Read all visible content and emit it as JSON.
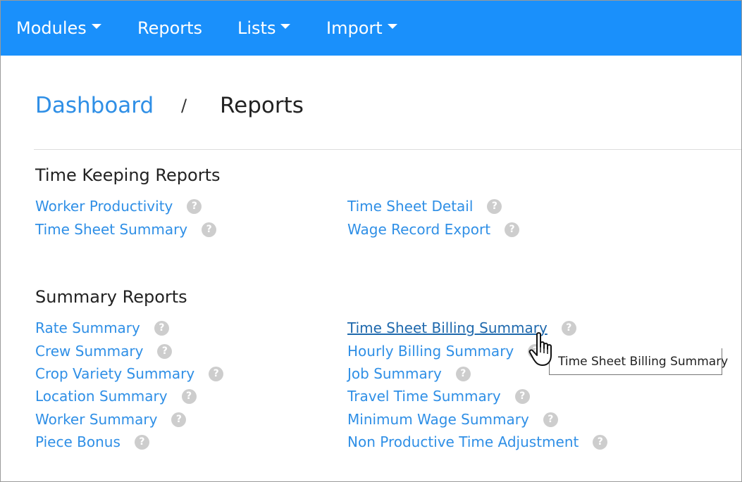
{
  "navbar": {
    "modules_label": "Modules",
    "reports_label": "Reports",
    "lists_label": "Lists",
    "import_label": "Import"
  },
  "breadcrumb": {
    "dashboard_label": "Dashboard",
    "separator": "/",
    "current_label": "Reports"
  },
  "sections": {
    "time_keeping": {
      "title": "Time Keeping Reports",
      "left": [
        "Worker Productivity",
        "Time Sheet Summary"
      ],
      "right": [
        "Time Sheet Detail",
        "Wage Record Export"
      ]
    },
    "summary": {
      "title": "Summary Reports",
      "left": [
        "Rate Summary",
        "Crew Summary",
        "Crop Variety Summary",
        "Location Summary",
        "Worker Summary",
        "Piece Bonus"
      ],
      "right": [
        "Time Sheet Billing Summary",
        "Hourly Billing Summary",
        "Job Summary",
        "Travel Time Summary",
        "Minimum Wage Summary",
        "Non Productive Time Adjustment"
      ]
    }
  },
  "help_icon_glyph": "?",
  "tooltip": {
    "text": "Time Sheet Billing Summary"
  },
  "colors": {
    "navbar": "#1a90fb",
    "link": "#2f8fe6",
    "link_hover": "#1f69ad",
    "help_icon": "#cdcdcd"
  },
  "icons": {
    "dropdown": "caret-down-icon",
    "help": "question-circle-icon",
    "cursor": "hand-pointer-cursor-icon"
  }
}
